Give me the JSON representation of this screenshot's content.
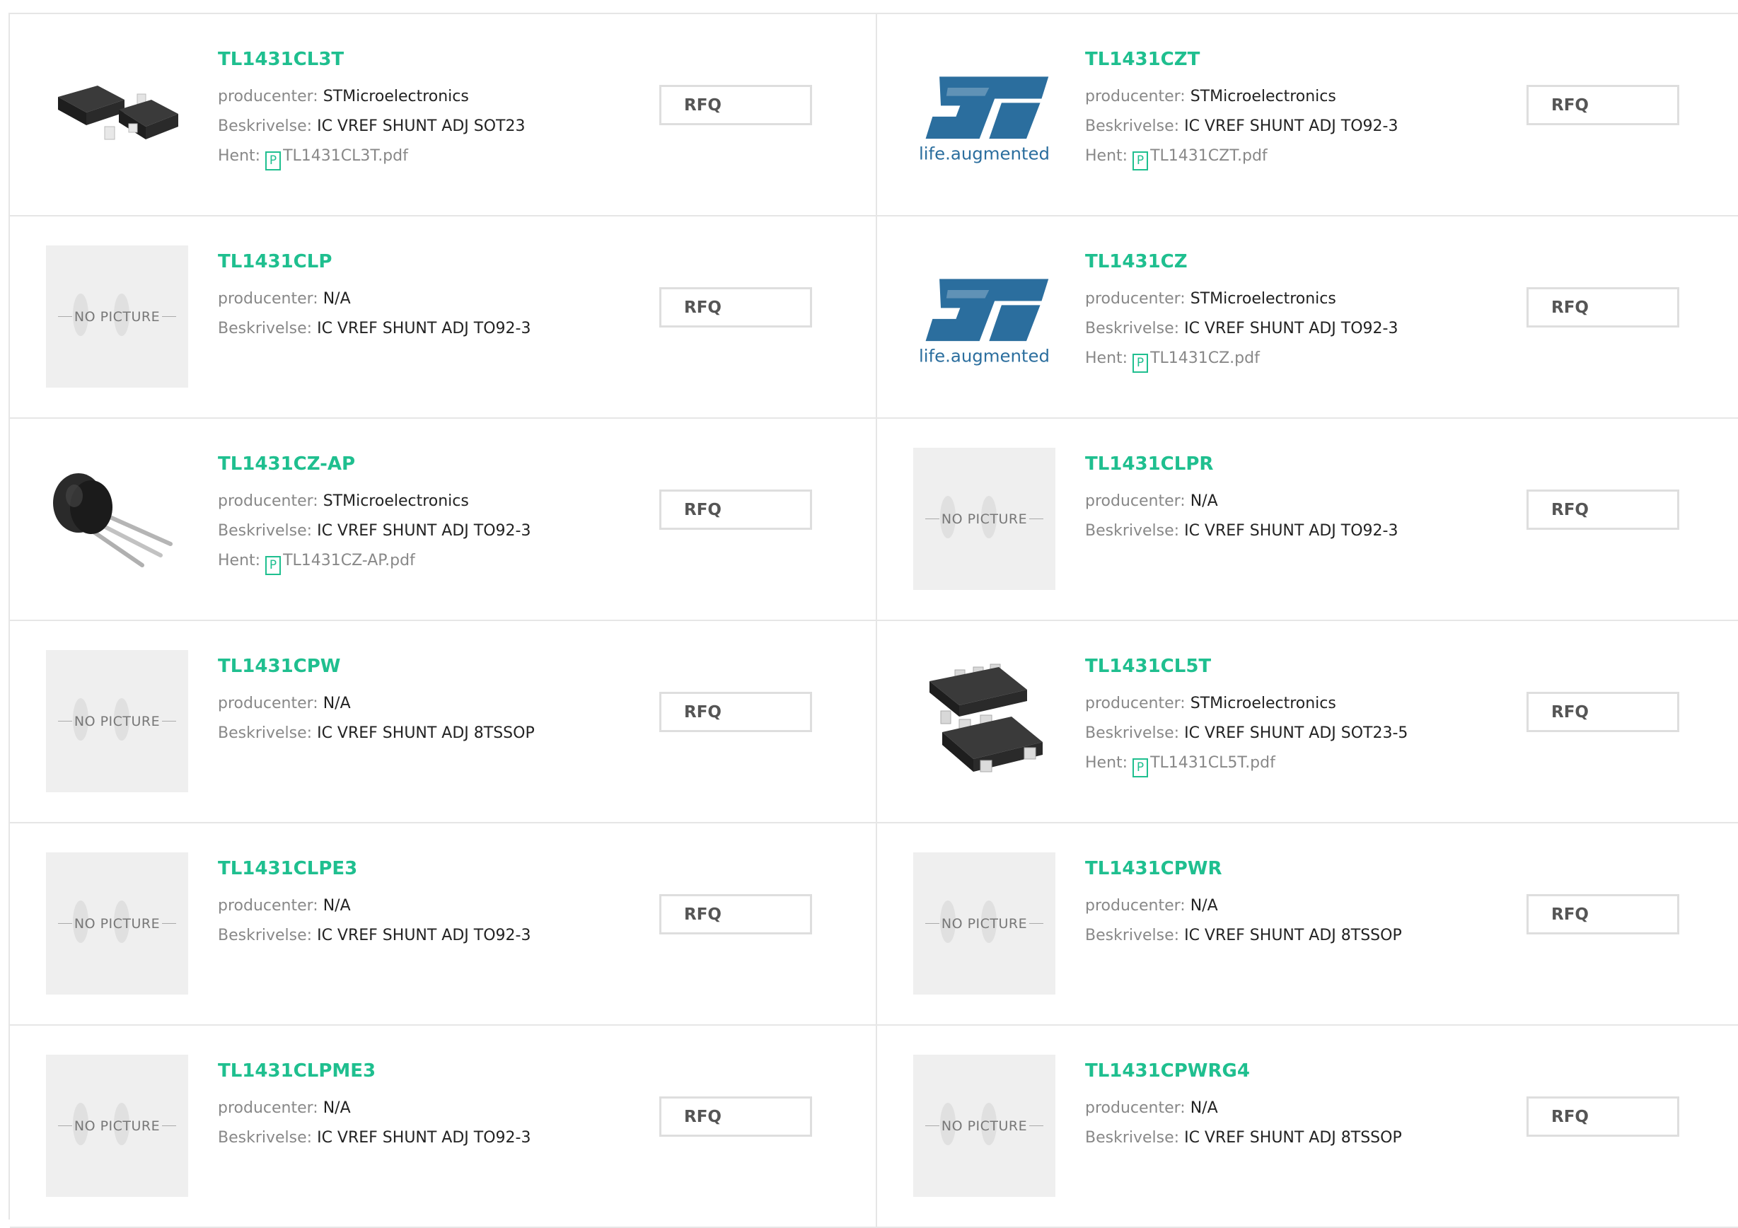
{
  "labels": {
    "producer": "producenter:",
    "description": "Beskrivelse:",
    "download": "Hent:",
    "rfq": "RFQ",
    "no_picture": "NO PICTURE",
    "logo_tagline": "life.augmented",
    "pdf_glyph": "P"
  },
  "colors": {
    "accent": "#1fbf8f",
    "st_blue": "#2b6e9e",
    "border": "#e6e6e6"
  },
  "products": [
    {
      "name": "TL1431CL3T",
      "producer": "STMicroelectronics",
      "description": "IC VREF SHUNT ADJ SOT23",
      "file": "TL1431CL3T.pdf",
      "image": "sot23-chip"
    },
    {
      "name": "TL1431CZT",
      "producer": "STMicroelectronics",
      "description": "IC VREF SHUNT ADJ TO92-3",
      "file": "TL1431CZT.pdf",
      "image": "st-logo"
    },
    {
      "name": "TL1431CLP",
      "producer": "N/A",
      "description": "IC VREF SHUNT ADJ TO92-3",
      "file": null,
      "image": "no-picture"
    },
    {
      "name": "TL1431CZ",
      "producer": "STMicroelectronics",
      "description": "IC VREF SHUNT ADJ TO92-3",
      "file": "TL1431CZ.pdf",
      "image": "st-logo"
    },
    {
      "name": "TL1431CZ-AP",
      "producer": "STMicroelectronics",
      "description": "IC VREF SHUNT ADJ TO92-3",
      "file": "TL1431CZ-AP.pdf",
      "image": "to92-transistor"
    },
    {
      "name": "TL1431CLPR",
      "producer": "N/A",
      "description": "IC VREF SHUNT ADJ TO92-3",
      "file": null,
      "image": "no-picture"
    },
    {
      "name": "TL1431CPW",
      "producer": "N/A",
      "description": "IC VREF SHUNT ADJ 8TSSOP",
      "file": null,
      "image": "no-picture"
    },
    {
      "name": "TL1431CL5T",
      "producer": "STMicroelectronics",
      "description": "IC VREF SHUNT ADJ SOT23-5",
      "file": "TL1431CL5T.pdf",
      "image": "sot23-5-chip"
    },
    {
      "name": "TL1431CLPE3",
      "producer": "N/A",
      "description": "IC VREF SHUNT ADJ TO92-3",
      "file": null,
      "image": "no-picture"
    },
    {
      "name": "TL1431CPWR",
      "producer": "N/A",
      "description": "IC VREF SHUNT ADJ 8TSSOP",
      "file": null,
      "image": "no-picture"
    },
    {
      "name": "TL1431CLPME3",
      "producer": "N/A",
      "description": "IC VREF SHUNT ADJ TO92-3",
      "file": null,
      "image": "no-picture"
    },
    {
      "name": "TL1431CPWRG4",
      "producer": "N/A",
      "description": "IC VREF SHUNT ADJ 8TSSOP",
      "file": null,
      "image": "no-picture"
    }
  ]
}
